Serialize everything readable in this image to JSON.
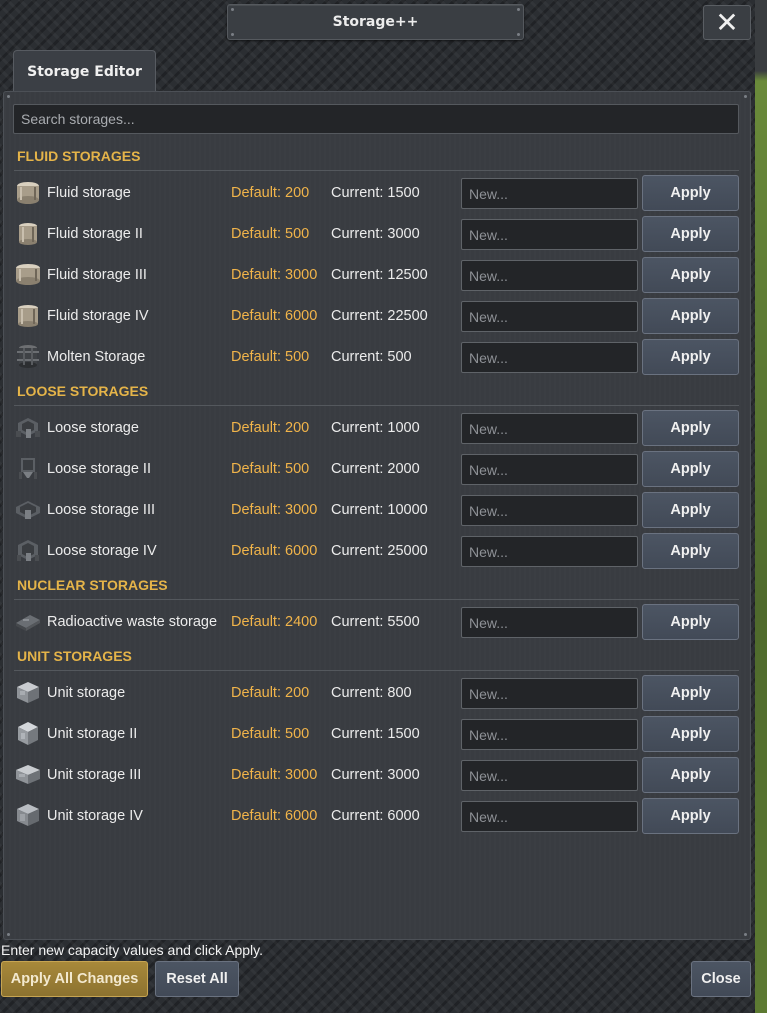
{
  "window": {
    "title": "Storage++",
    "close_glyph": "✕"
  },
  "tabs": [
    {
      "label": "Storage Editor"
    }
  ],
  "search": {
    "placeholder": "Search storages...",
    "value": ""
  },
  "sections": [
    {
      "title": "FLUID STORAGES",
      "items": [
        {
          "name": "Fluid storage",
          "default": "Default: 200",
          "current": "Current: 1500",
          "icon": "fluid-tank-icon",
          "placeholder": "New...",
          "apply": "Apply"
        },
        {
          "name": "Fluid storage II",
          "default": "Default: 500",
          "current": "Current: 3000",
          "icon": "fluid-tank-icon",
          "placeholder": "New...",
          "apply": "Apply"
        },
        {
          "name": "Fluid storage III",
          "default": "Default: 3000",
          "current": "Current: 12500",
          "icon": "fluid-tank-icon",
          "placeholder": "New...",
          "apply": "Apply"
        },
        {
          "name": "Fluid storage IV",
          "default": "Default: 6000",
          "current": "Current: 22500",
          "icon": "fluid-tank-icon",
          "placeholder": "New...",
          "apply": "Apply"
        },
        {
          "name": "Molten Storage",
          "default": "Default: 500",
          "current": "Current: 500",
          "icon": "molten-tank-icon",
          "placeholder": "New...",
          "apply": "Apply"
        }
      ]
    },
    {
      "title": "LOOSE STORAGES",
      "items": [
        {
          "name": "Loose storage",
          "default": "Default: 200",
          "current": "Current: 1000",
          "icon": "loose-silo-icon",
          "placeholder": "New...",
          "apply": "Apply"
        },
        {
          "name": "Loose storage II",
          "default": "Default: 500",
          "current": "Current: 2000",
          "icon": "loose-silo-icon",
          "placeholder": "New...",
          "apply": "Apply"
        },
        {
          "name": "Loose storage III",
          "default": "Default: 3000",
          "current": "Current: 10000",
          "icon": "loose-silo-icon",
          "placeholder": "New...",
          "apply": "Apply"
        },
        {
          "name": "Loose storage IV",
          "default": "Default: 6000",
          "current": "Current: 25000",
          "icon": "loose-silo-icon",
          "placeholder": "New...",
          "apply": "Apply"
        }
      ]
    },
    {
      "title": "NUCLEAR STORAGES",
      "items": [
        {
          "name": "Radioactive waste storage",
          "default": "Default: 2400",
          "current": "Current: 5500",
          "icon": "radioactive-waste-icon",
          "placeholder": "New...",
          "apply": "Apply"
        }
      ]
    },
    {
      "title": "UNIT STORAGES",
      "items": [
        {
          "name": "Unit storage",
          "default": "Default: 200",
          "current": "Current: 800",
          "icon": "unit-crate-icon",
          "placeholder": "New...",
          "apply": "Apply"
        },
        {
          "name": "Unit storage II",
          "default": "Default: 500",
          "current": "Current: 1500",
          "icon": "unit-crate-icon",
          "placeholder": "New...",
          "apply": "Apply"
        },
        {
          "name": "Unit storage III",
          "default": "Default: 3000",
          "current": "Current: 3000",
          "icon": "unit-crate-icon",
          "placeholder": "New...",
          "apply": "Apply"
        },
        {
          "name": "Unit storage IV",
          "default": "Default: 6000",
          "current": "Current: 6000",
          "icon": "unit-crate-icon",
          "placeholder": "New...",
          "apply": "Apply"
        }
      ]
    }
  ],
  "footer": {
    "hint": "Enter new capacity values and click Apply.",
    "apply_all": "Apply All Changes",
    "reset_all": "Reset All",
    "close": "Close"
  },
  "colors": {
    "accent": "#e5b449",
    "default_value": "#f1b44a",
    "apply_all_bg": "#9a7e35"
  }
}
